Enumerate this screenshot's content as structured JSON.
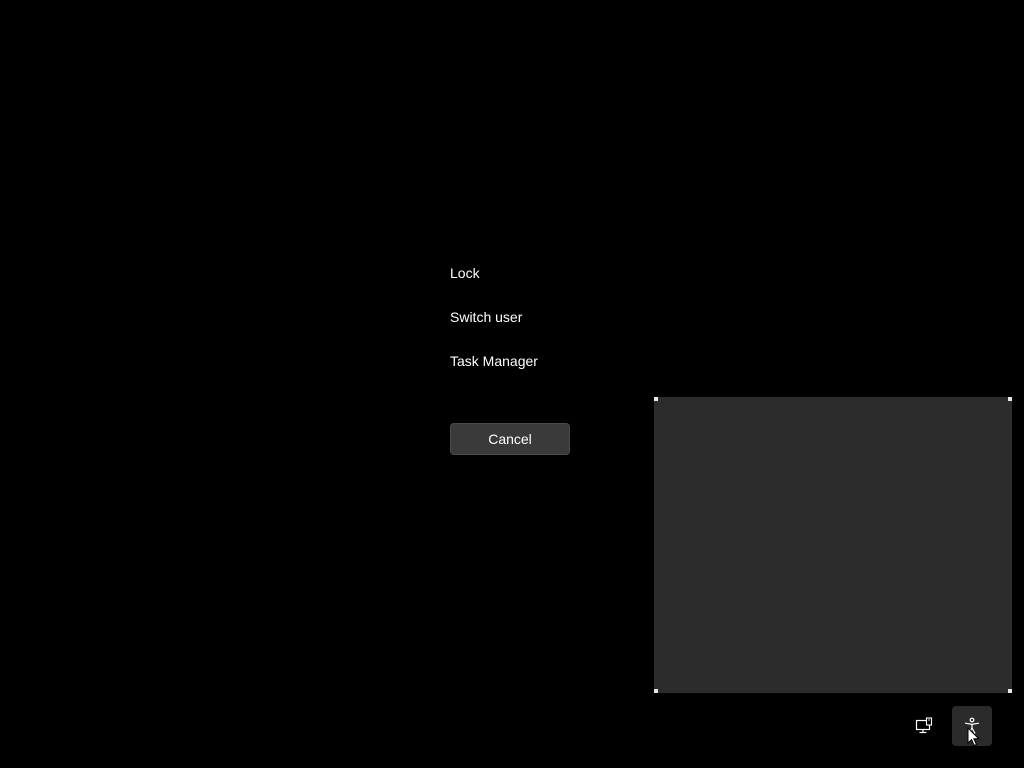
{
  "menu": {
    "lock": "Lock",
    "switch_user": "Switch user",
    "task_manager": "Task Manager"
  },
  "cancel_label": "Cancel",
  "tray": {
    "network_icon": "network-icon",
    "accessibility_icon": "accessibility-icon"
  },
  "colors": {
    "background": "#000000",
    "panel": "#2c2c2c",
    "button": "#3a3a3a",
    "text": "#ffffff"
  }
}
